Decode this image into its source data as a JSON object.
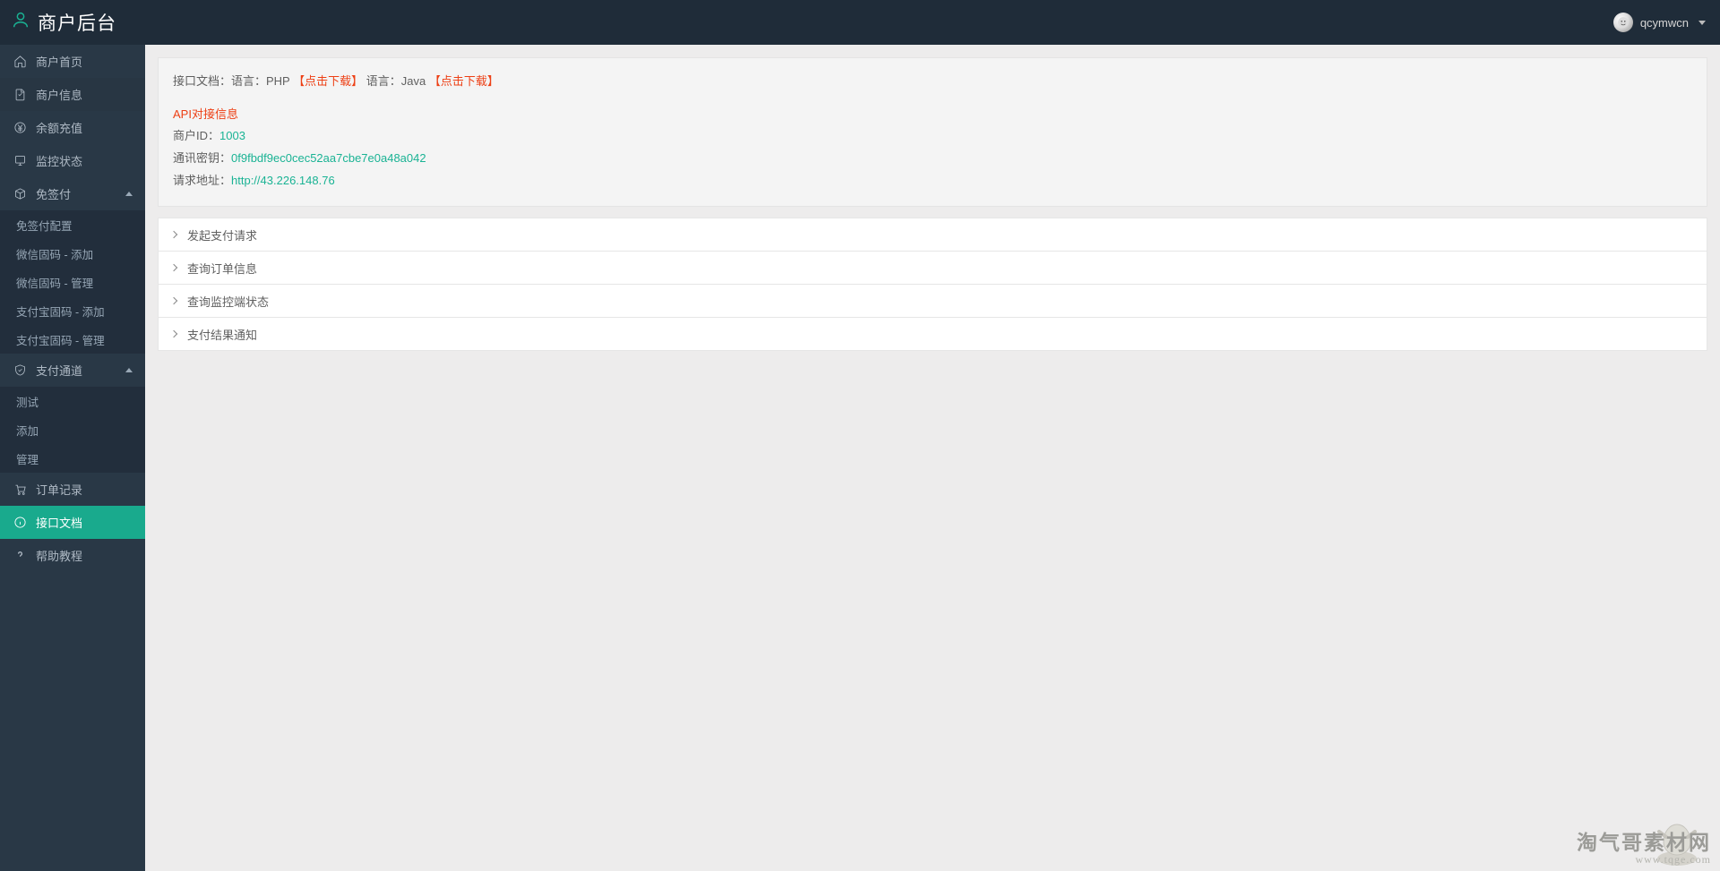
{
  "header": {
    "title": "商户后台",
    "username": "qcymwcn"
  },
  "sidebar": [
    {
      "label": "商户首页",
      "icon": "home"
    },
    {
      "label": "商户信息",
      "icon": "doc",
      "highlight": true
    },
    {
      "label": "余额充值",
      "icon": "yen"
    },
    {
      "label": "监控状态",
      "icon": "monitor"
    },
    {
      "label": "免签付",
      "icon": "box",
      "expandable": true,
      "children": [
        "免签付配置",
        "微信固码 - 添加",
        "微信固码 - 管理",
        "支付宝固码 - 添加",
        "支付宝固码 - 管理"
      ]
    },
    {
      "label": "支付通道",
      "icon": "shield",
      "expandable": true,
      "children": [
        "测试",
        "添加",
        "管理"
      ]
    },
    {
      "label": "订单记录",
      "icon": "cart"
    },
    {
      "label": "接口文档",
      "icon": "info",
      "active": true
    },
    {
      "label": "帮助教程",
      "icon": "help"
    }
  ],
  "doc": {
    "line_prefix": "接口文档：语言：PHP",
    "download1": "【点击下载】",
    "line_mid": " 语言：Java",
    "download2": "【点击下载】",
    "api_title": "API对接信息",
    "merchant_label": "商户ID：",
    "merchant_id": "1003",
    "key_label": "通讯密钥：",
    "key_value": "0f9fbdf9ec0cec52aa7cbe7e0a48a042",
    "url_label": "请求地址：",
    "url_value": "http://43.226.148.76"
  },
  "accordion": [
    "发起支付请求",
    "查询订单信息",
    "查询监控端状态",
    "支付结果通知"
  ],
  "watermark": {
    "line1": "淘气哥素材网",
    "line2": "www.tqge.com"
  }
}
